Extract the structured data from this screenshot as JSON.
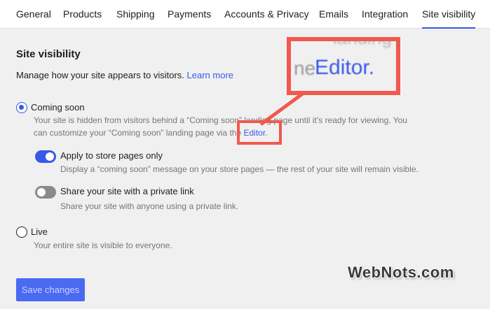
{
  "tabs": [
    {
      "label": "General"
    },
    {
      "label": "Products"
    },
    {
      "label": "Shipping"
    },
    {
      "label": "Payments"
    },
    {
      "label": "Accounts & Privacy"
    },
    {
      "label": "Emails"
    },
    {
      "label": "Integration"
    },
    {
      "label": "Site visibility",
      "active": true
    }
  ],
  "section": {
    "title": "Site visibility",
    "intro": "Manage how your site appears to visitors.",
    "learn_more": "Learn more"
  },
  "options": {
    "coming_soon": {
      "label": "Coming soon",
      "selected": true,
      "help_line1": "Your site is hidden from visitors behind a “Coming soon” landing page until it’s ready for viewing. You",
      "help_line2_prefix": "can customize your “Coming soon” landing page via the ",
      "help_line2_link": "Editor",
      "help_line2_suffix": "."
    },
    "store_pages_only": {
      "label": "Apply to store pages only",
      "enabled": true,
      "help": "Display a “coming soon” message on your store pages — the rest of your site will remain visible."
    },
    "private_link": {
      "label": "Share your site with a private link",
      "enabled": false,
      "help": "Share your site with anyone using a private link."
    },
    "live": {
      "label": "Live",
      "selected": false,
      "help": "Your entire site is visible to everyone."
    }
  },
  "save_button": "Save changes",
  "callout": {
    "zoom_top": "landing",
    "zoom_prefix": "ne",
    "zoom_text": "Editor."
  },
  "watermark": "WebNots.com",
  "colors": {
    "accent": "#3858e9",
    "callout": "#f1584f",
    "toggle_off": "#8a8a8a"
  }
}
